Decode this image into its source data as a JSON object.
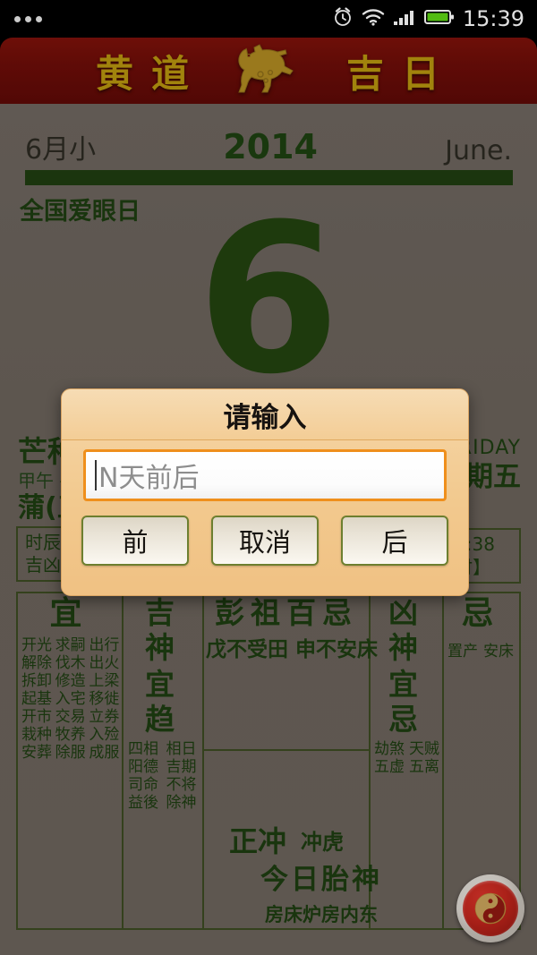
{
  "statusbar": {
    "time": "15:39",
    "icons": [
      "alarm-icon",
      "wifi-icon",
      "signal-icon",
      "battery-icon"
    ]
  },
  "banner": {
    "char1": "黄",
    "char2": "道",
    "zodiac_icon": "horse-icon",
    "char3": "吉",
    "char4": "日"
  },
  "calendar": {
    "lunar_month": "6月小",
    "year": "2014",
    "month_en": "June.",
    "festival": "全国爱眼日",
    "day": "6",
    "solar_term": "芒种",
    "ganzhi": "甲午 -",
    "lunar_day": "蒲(五",
    "weekday_en": "RIDAY",
    "weekday_cn": "期五",
    "shichen_l1": "时辰",
    "shichen_l2": "吉凶",
    "time_l1": "9:38",
    "time_l2": "时】"
  },
  "table": {
    "yi": {
      "header": "宜",
      "items": [
        "开光",
        "求嗣",
        "出行",
        "解除",
        "伐木",
        "出火",
        "拆卸",
        "修造",
        "上梁",
        "起基",
        "入宅",
        "移徙",
        "开市",
        "交易",
        "立券",
        "栽种",
        "牧养",
        "入殓",
        "安葬",
        "除服",
        "成服"
      ]
    },
    "jishen": {
      "header1": "吉 神",
      "header2": "宜 趋",
      "items": [
        "四相",
        "相日",
        "阳德",
        "吉期",
        "司命",
        "不将",
        "益後",
        "除神"
      ]
    },
    "pengzu": {
      "header": "彭祖百忌",
      "text": "戊不受田 申不安床"
    },
    "zhengchong": {
      "label": "正冲",
      "value": "冲虎"
    },
    "xiongshen": {
      "header1": "凶 神",
      "header2": "宜 忌",
      "items": [
        "劫煞",
        "天贼",
        "五虚",
        "五离"
      ]
    },
    "ji": {
      "header": "忌",
      "items": [
        "置产",
        "安床"
      ]
    },
    "taishen": {
      "header": "今日胎神",
      "text": "房床炉房内东"
    }
  },
  "fab": {
    "icon": "yinyang-icon"
  },
  "dialog": {
    "title": "请输入",
    "input_value": "",
    "input_placeholder": "N天前后",
    "btn_prev": "前",
    "btn_cancel": "取消",
    "btn_next": "后"
  },
  "colors": {
    "banner_red": "#6d0d08",
    "banner_gold": "#b8960f",
    "ink_green": "#1d3d10",
    "paper": "#6a625b",
    "dialog_bg": "#f2c98e",
    "input_border": "#ef8f1c",
    "fab_red": "#c3261d"
  }
}
